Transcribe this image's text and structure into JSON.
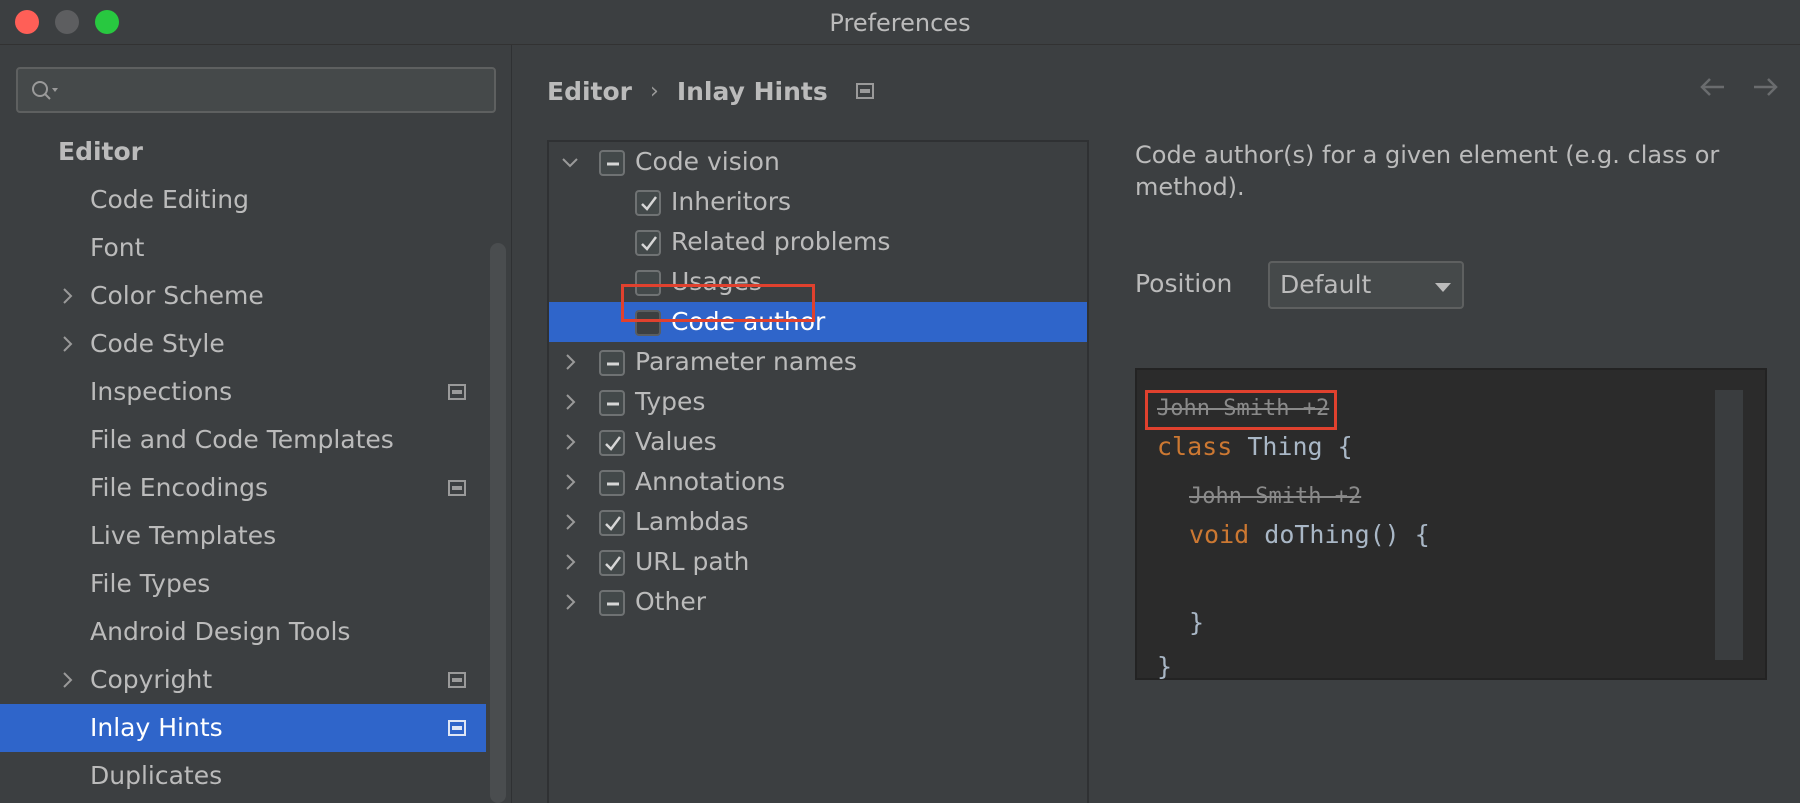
{
  "window": {
    "title": "Preferences"
  },
  "sidebar": {
    "search": {
      "placeholder": "",
      "value": ""
    },
    "section": "Editor",
    "items": [
      {
        "label": "Code Editing",
        "expandable": false,
        "has_icon": false
      },
      {
        "label": "Font",
        "expandable": false,
        "has_icon": false
      },
      {
        "label": "Color Scheme",
        "expandable": true,
        "has_icon": false
      },
      {
        "label": "Code Style",
        "expandable": true,
        "has_icon": false
      },
      {
        "label": "Inspections",
        "expandable": false,
        "has_icon": true
      },
      {
        "label": "File and Code Templates",
        "expandable": false,
        "has_icon": false
      },
      {
        "label": "File Encodings",
        "expandable": false,
        "has_icon": true
      },
      {
        "label": "Live Templates",
        "expandable": false,
        "has_icon": false
      },
      {
        "label": "File Types",
        "expandable": false,
        "has_icon": false
      },
      {
        "label": "Android Design Tools",
        "expandable": false,
        "has_icon": false
      },
      {
        "label": "Copyright",
        "expandable": true,
        "has_icon": true
      },
      {
        "label": "Inlay Hints",
        "expandable": false,
        "has_icon": true,
        "selected": true
      },
      {
        "label": "Duplicates",
        "expandable": false,
        "has_icon": false
      }
    ]
  },
  "breadcrumb": {
    "parent": "Editor",
    "separator": "›",
    "current": "Inlay Hints"
  },
  "hints_tree": [
    {
      "label": "Code vision",
      "level": 0,
      "expanded": true,
      "state": "partial"
    },
    {
      "label": "Inheritors",
      "level": 1,
      "state": "checked"
    },
    {
      "label": "Related problems",
      "level": 1,
      "state": "checked"
    },
    {
      "label": "Usages",
      "level": 1,
      "state": "unchecked"
    },
    {
      "label": "Code author",
      "level": 1,
      "state": "unchecked",
      "selected": true
    },
    {
      "label": "Parameter names",
      "level": 0,
      "expanded": false,
      "state": "partial"
    },
    {
      "label": "Types",
      "level": 0,
      "expanded": false,
      "state": "partial"
    },
    {
      "label": "Values",
      "level": 0,
      "expanded": false,
      "state": "checked"
    },
    {
      "label": "Annotations",
      "level": 0,
      "expanded": false,
      "state": "partial"
    },
    {
      "label": "Lambdas",
      "level": 0,
      "expanded": false,
      "state": "checked"
    },
    {
      "label": "URL path",
      "level": 0,
      "expanded": false,
      "state": "checked"
    },
    {
      "label": "Other",
      "level": 0,
      "expanded": false,
      "state": "partial"
    }
  ],
  "description": "Code author(s) for a given element (e.g. class or method).",
  "position": {
    "label": "Position",
    "value": "Default"
  },
  "preview": {
    "hint1": "John Smith +2",
    "line1_kw": "class",
    "line1_rest": " Thing {",
    "hint2": "John Smith +2",
    "line2_kw": "void",
    "line2_rest": " doThing() {",
    "line3": "}",
    "line4": "}"
  },
  "colors": {
    "selection": "#2f65ca",
    "highlight_box": "#e0412e",
    "keyword": "#cc7832"
  }
}
